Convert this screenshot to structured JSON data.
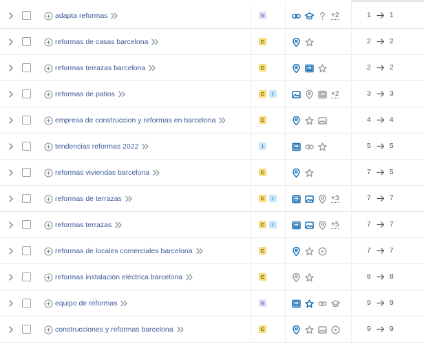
{
  "colors": {
    "keyword": "#3b5a99",
    "badge_n_bg": "#e3dcf6",
    "badge_n_fg": "#8a63c9",
    "badge_c_bg": "#f6dc7a",
    "badge_c_fg": "#6b5600",
    "badge_i_bg": "#c9e6f8",
    "badge_i_fg": "#2f7fc1",
    "feature_active": "#1b70b3",
    "feature_inactive": "#9aa0a8"
  },
  "rows": [
    {
      "keyword": "adapta reformas",
      "badges": [
        "N"
      ],
      "features": [
        {
          "icon": "link-icon",
          "active": true
        },
        {
          "icon": "graduation-cap-icon",
          "active": true
        },
        {
          "icon": "question-icon",
          "active": false
        }
      ],
      "more": "+2",
      "prev": "1",
      "curr": "1"
    },
    {
      "keyword": "reformas de casas barcelona",
      "badges": [
        "C"
      ],
      "features": [
        {
          "icon": "map-pin-icon",
          "active": true
        },
        {
          "icon": "star-icon",
          "active": false
        }
      ],
      "more": "",
      "prev": "2",
      "curr": "2"
    },
    {
      "keyword": "reformas terrazas barcelona",
      "badges": [
        "C"
      ],
      "features": [
        {
          "icon": "map-pin-icon",
          "active": true
        },
        {
          "icon": "image-pack-icon",
          "active": true
        },
        {
          "icon": "star-icon",
          "active": false
        }
      ],
      "more": "",
      "prev": "2",
      "curr": "2"
    },
    {
      "keyword": "reformas de patios",
      "badges": [
        "C",
        "I"
      ],
      "features": [
        {
          "icon": "image-icon",
          "active": true
        },
        {
          "icon": "map-pin-icon",
          "active": false
        },
        {
          "icon": "image-pack-icon",
          "active": false
        }
      ],
      "more": "+2",
      "prev": "3",
      "curr": "3"
    },
    {
      "keyword": "empresa de construccion y reformas en barcelona",
      "badges": [
        "C"
      ],
      "features": [
        {
          "icon": "map-pin-icon",
          "active": true
        },
        {
          "icon": "star-icon",
          "active": false
        },
        {
          "icon": "image-icon",
          "active": false
        }
      ],
      "more": "",
      "prev": "4",
      "curr": "4"
    },
    {
      "keyword": "tendencias reformas 2022",
      "badges": [
        "I"
      ],
      "features": [
        {
          "icon": "image-pack-icon",
          "active": true
        },
        {
          "icon": "link-icon",
          "active": false
        },
        {
          "icon": "star-icon",
          "active": false
        }
      ],
      "more": "",
      "prev": "5",
      "curr": "5"
    },
    {
      "keyword": "reformas viviendas barcelona",
      "badges": [
        "C"
      ],
      "features": [
        {
          "icon": "map-pin-icon",
          "active": true
        },
        {
          "icon": "star-icon",
          "active": false
        }
      ],
      "more": "",
      "prev": "7",
      "curr": "5"
    },
    {
      "keyword": "reformas de terrazas",
      "badges": [
        "C",
        "I"
      ],
      "features": [
        {
          "icon": "image-pack-icon",
          "active": true
        },
        {
          "icon": "image-icon",
          "active": true
        },
        {
          "icon": "map-pin-icon",
          "active": false
        }
      ],
      "more": "+3",
      "prev": "7",
      "curr": "7"
    },
    {
      "keyword": "reformas terrazas",
      "badges": [
        "C",
        "I"
      ],
      "features": [
        {
          "icon": "image-pack-icon",
          "active": true
        },
        {
          "icon": "image-icon",
          "active": true
        },
        {
          "icon": "map-pin-icon",
          "active": false
        }
      ],
      "more": "+5",
      "prev": "7",
      "curr": "7"
    },
    {
      "keyword": "reformas de locales comerciales barcelona",
      "badges": [
        "C"
      ],
      "features": [
        {
          "icon": "map-pin-icon",
          "active": true
        },
        {
          "icon": "star-icon",
          "active": false
        },
        {
          "icon": "video-icon",
          "active": false
        }
      ],
      "more": "",
      "prev": "7",
      "curr": "7"
    },
    {
      "keyword": "reformas instalación eléctrica barcelona",
      "badges": [
        "C"
      ],
      "features": [
        {
          "icon": "map-pin-icon",
          "active": false
        },
        {
          "icon": "star-icon",
          "active": false
        }
      ],
      "more": "",
      "prev": "8",
      "curr": "8"
    },
    {
      "keyword": "equipo de reformas",
      "badges": [
        "N"
      ],
      "features": [
        {
          "icon": "image-pack-icon",
          "active": true
        },
        {
          "icon": "star-icon",
          "active": true
        },
        {
          "icon": "link-icon",
          "active": false
        },
        {
          "icon": "graduation-cap-icon",
          "active": false
        }
      ],
      "more": "",
      "prev": "9",
      "curr": "9"
    },
    {
      "keyword": "construcciones y reformas barcelona",
      "badges": [
        "C"
      ],
      "features": [
        {
          "icon": "map-pin-icon",
          "active": true
        },
        {
          "icon": "star-icon",
          "active": false
        },
        {
          "icon": "image-icon",
          "active": false
        },
        {
          "icon": "video-icon",
          "active": false
        }
      ],
      "more": "",
      "prev": "9",
      "curr": "9"
    }
  ]
}
